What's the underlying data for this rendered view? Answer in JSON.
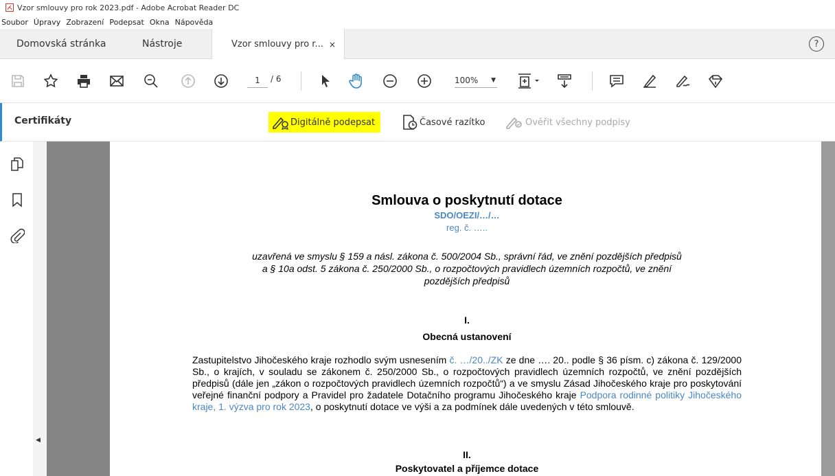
{
  "window": {
    "title": "Vzor smlouvy pro rok 2023.pdf - Adobe Acrobat Reader DC"
  },
  "menu": {
    "items": [
      "Soubor",
      "Úpravy",
      "Zobrazení",
      "Podepsat",
      "Okna",
      "Nápověda"
    ]
  },
  "tabs": {
    "home": "Domovská stránka",
    "tools": "Nástroje",
    "document": "Vzor smlouvy pro r...",
    "close_glyph": "×",
    "help_glyph": "?"
  },
  "toolbar": {
    "current_page": "1",
    "total_pages": "/ 6",
    "zoom": "100%",
    "zoom_caret": "▼"
  },
  "certificates": {
    "title": "Certifikáty",
    "sign_label": "Digitálně podepsat",
    "timestamp_label": "Časové razítko",
    "verify_label": "Ověřit všechny podpisy"
  },
  "document": {
    "title": "Smlouva o poskytnutí dotace",
    "code": "SDO/OEZI/…/…",
    "reg": "reg. č. …..",
    "italic_lines": [
      "uzavřená ve smyslu § 159 a násl. zákona č. 500/2004 Sb., správní řád, ve znění pozdějších předpisů",
      "a § 10a odst. 5 zákona č. 250/2000 Sb., o rozpočtových pravidlech územních rozpočtů, ve znění",
      "pozdějších předpisů"
    ],
    "section1_num": "I.",
    "section1_title": "Obecná ustanovení",
    "para_1": "Zastupitelstvo Jihočeského kraje rozhodlo svým usnesením ",
    "para_2": "č. …/20../ZK",
    "para_3": " ze dne …. 20.. podle § 36 písm. c) zákona č. 129/2000 Sb., o krajích, v souladu se zákonem č. 250/2000 Sb., o rozpočtových pravidlech územních rozpočtů, ve znění pozdějších předpisů (dále jen „zákon o rozpočtových pravidlech územních rozpočtů“) a ve smyslu Zásad Jihočeského kraje pro poskytování veřejné finanční podpory a Pravidel pro žadatele Dotačního programu Jihočeského kraje ",
    "para_4": "Podpora rodinné politiky Jihočeského kraje, 1. výzva pro rok 2023",
    "para_5": ", o poskytnutí dotace ve výši a za podmínek dále uvedených v této smlouvě.",
    "section2_num": "II.",
    "section2_title": "Poskytovatel a příjemce dotace"
  },
  "sidebar": {
    "collapse_glyph": "◀"
  },
  "colors": {
    "accent": "#2d8ad4",
    "highlight": "#ffff00",
    "link_blue": "#4a86c6",
    "app_red": "#d9342b"
  }
}
